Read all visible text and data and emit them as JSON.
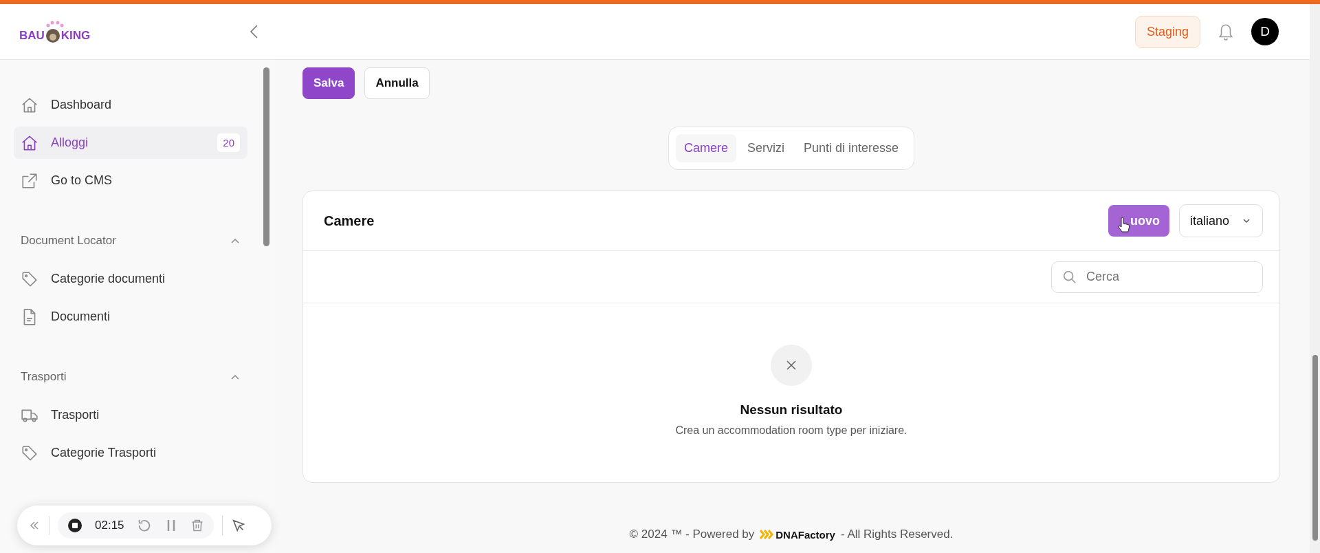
{
  "header": {
    "logo": {
      "left": "BAU",
      "right": "KING"
    },
    "env_badge": "Staging",
    "avatar": "D"
  },
  "sidebar": {
    "items": [
      {
        "label": "Dashboard",
        "selected": false
      },
      {
        "label": "Alloggi",
        "selected": true,
        "badge": "20"
      },
      {
        "label": "Go to CMS",
        "selected": false
      }
    ],
    "sections": [
      {
        "title": "Document Locator",
        "expanded": true,
        "items": [
          {
            "label": "Categorie documenti",
            "selected": false
          },
          {
            "label": "Documenti",
            "selected": false
          }
        ]
      },
      {
        "title": "Trasporti",
        "expanded": true,
        "items": [
          {
            "label": "Trasporti",
            "selected": false
          },
          {
            "label": "Categorie Trasporti",
            "selected": false
          }
        ]
      }
    ]
  },
  "recorder": {
    "time": "02:15"
  },
  "actions": [
    {
      "label": "Salva",
      "kind": "primary"
    },
    {
      "label": "Annulla",
      "kind": "secondary"
    }
  ],
  "tabs": [
    {
      "label": "Camere",
      "selected": true
    },
    {
      "label": "Servizi",
      "selected": false
    },
    {
      "label": "Punti di interesse",
      "selected": false
    }
  ],
  "card": {
    "title": "Camere",
    "new_button": "uovo",
    "language": "italiano",
    "search": {
      "placeholder": "Cerca"
    },
    "empty": {
      "title": "Nessun risultato",
      "message": "Crea un accommodation room type per iniziare."
    }
  },
  "footer": {
    "left": "© 2024 ™ - Powered by",
    "brand": "DNAFactory",
    "right": "- All Rights Reserved."
  }
}
